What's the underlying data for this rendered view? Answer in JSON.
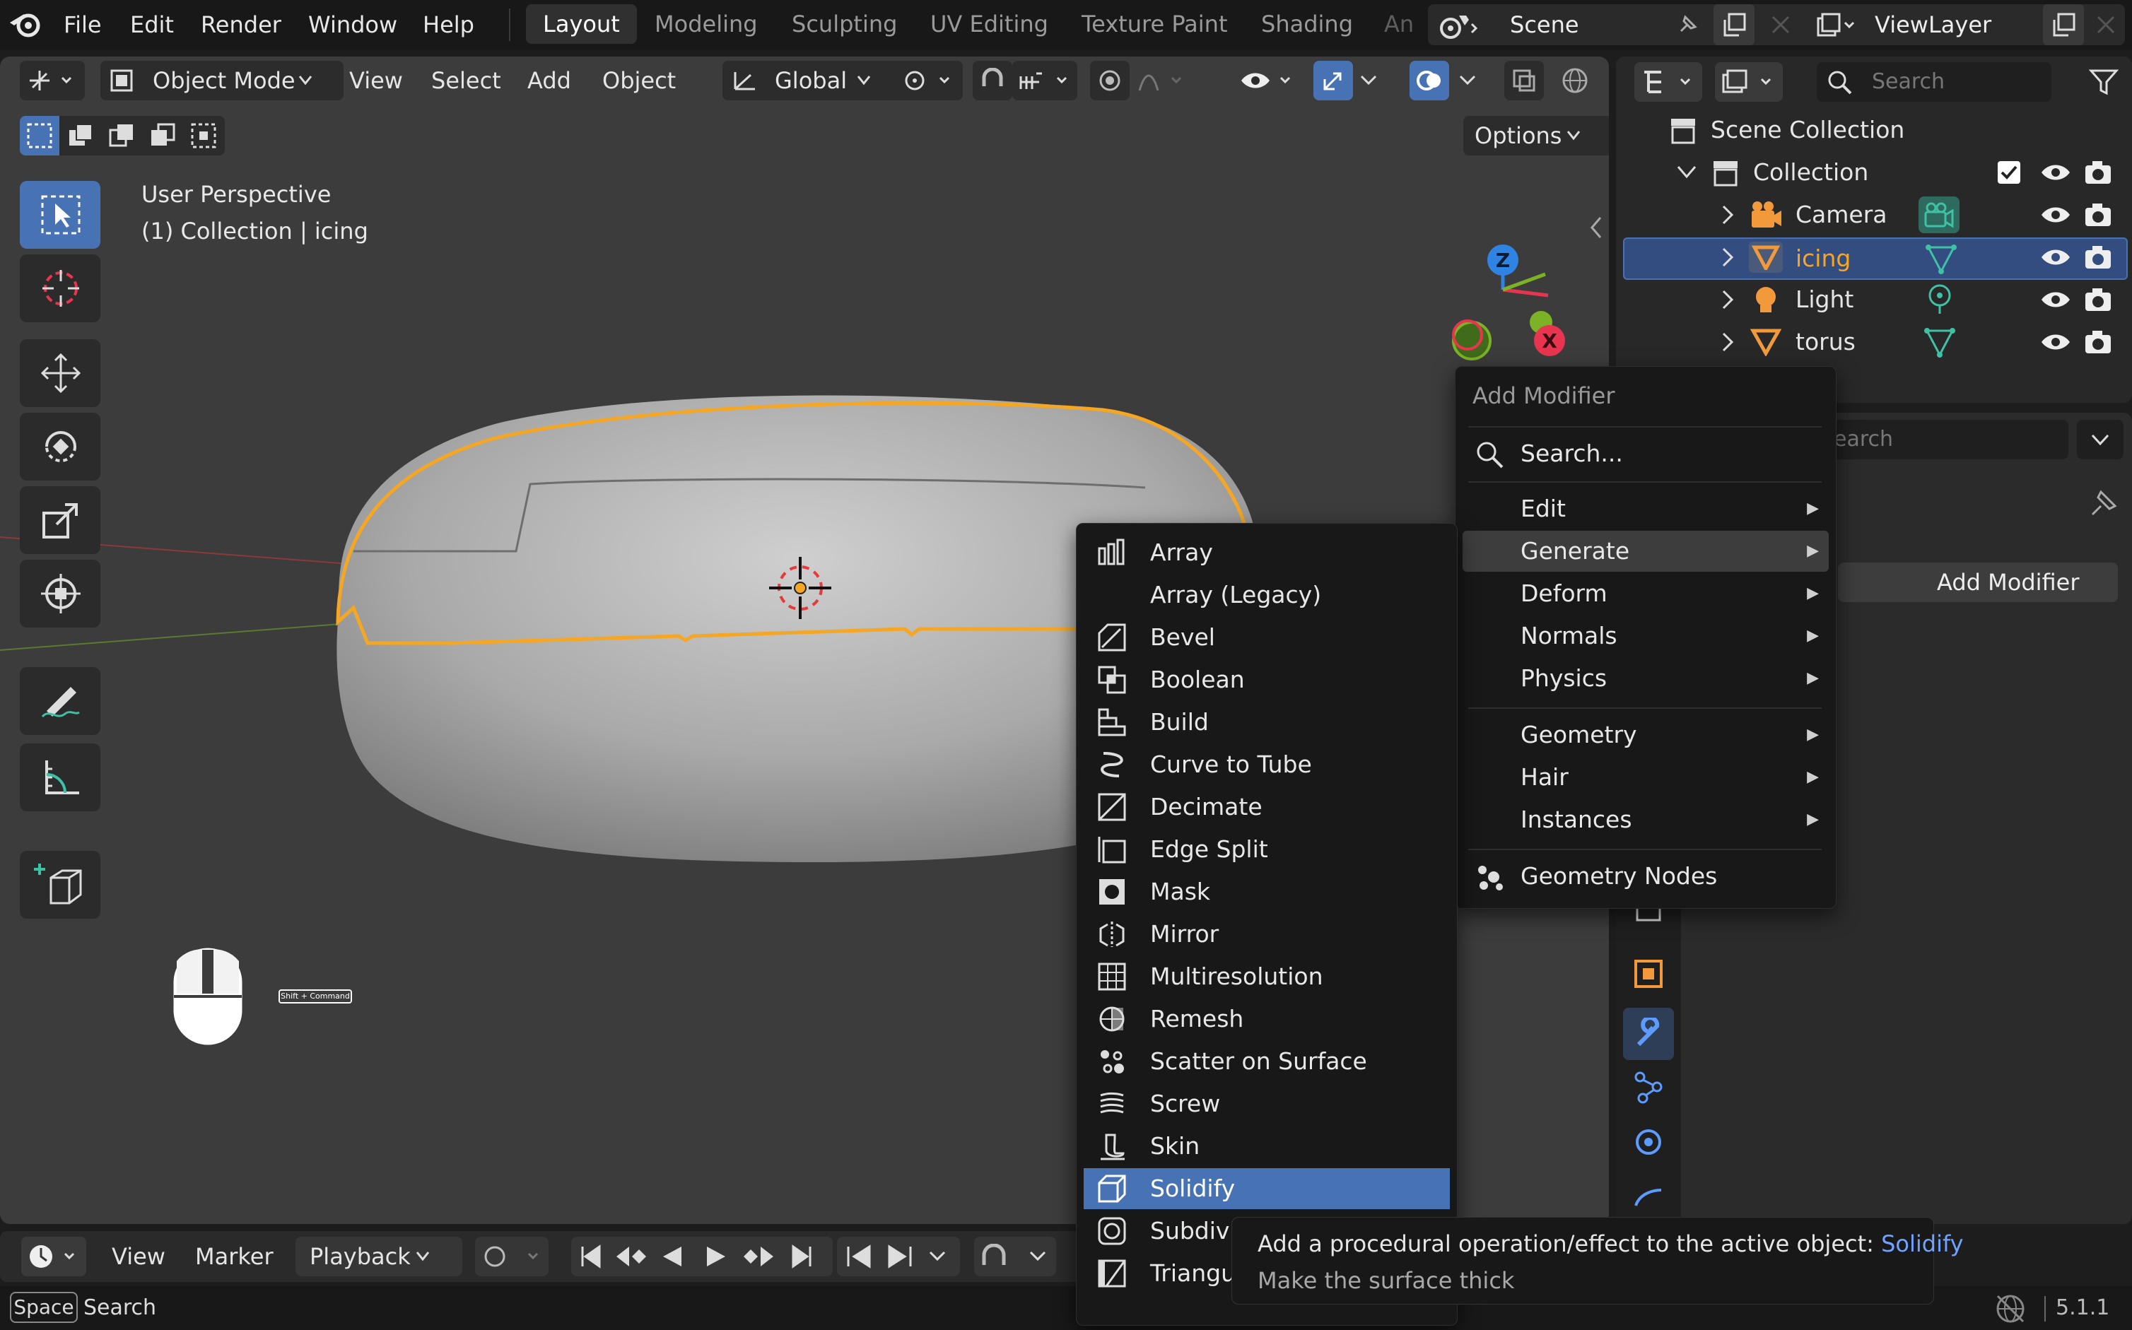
{
  "menubar": {
    "items": [
      "File",
      "Edit",
      "Render",
      "Window",
      "Help"
    ],
    "workspaces": [
      "Layout",
      "Modeling",
      "Sculpting",
      "UV Editing",
      "Texture Paint",
      "Shading",
      "An"
    ],
    "active_workspace": "Layout",
    "scene": "Scene",
    "view_layer": "ViewLayer"
  },
  "viewport": {
    "mode": "Object Mode",
    "menus": [
      "View",
      "Select",
      "Add",
      "Object"
    ],
    "orientation": "Global",
    "options_label": "Options",
    "overlay_line1": "User Perspective",
    "overlay_line2": "(1) Collection | icing",
    "shortcut_hint": "Shift + Command",
    "gizmo_axes": {
      "z": "Z",
      "x": "X"
    }
  },
  "timeline": {
    "menus": [
      "View",
      "Marker"
    ],
    "playback": "Playback"
  },
  "statusbar": {
    "key": "Space",
    "key_action": "Search",
    "version": "5.1.1"
  },
  "outliner": {
    "search_placeholder": "Search",
    "root": "Scene Collection",
    "collection": "Collection",
    "objects": [
      {
        "name": "Camera",
        "type": "camera"
      },
      {
        "name": "icing",
        "type": "mesh",
        "selected": true
      },
      {
        "name": "Light",
        "type": "light"
      },
      {
        "name": "torus",
        "type": "mesh"
      }
    ]
  },
  "properties": {
    "search_fragment": "earch",
    "add_modifier_button": "Add Modifier"
  },
  "add_modifier_menu": {
    "title": "Add Modifier",
    "search": "Search...",
    "items": [
      "Edit",
      "Generate",
      "Deform",
      "Normals",
      "Physics",
      "Geometry",
      "Hair",
      "Instances"
    ],
    "highlighted": "Generate",
    "geometry_nodes": "Geometry Nodes"
  },
  "generate_menu": {
    "items": [
      "Array",
      "Array (Legacy)",
      "Bevel",
      "Boolean",
      "Build",
      "Curve to Tube",
      "Decimate",
      "Edge Split",
      "Mask",
      "Mirror",
      "Multiresolution",
      "Remesh",
      "Scatter on Surface",
      "Screw",
      "Skin",
      "Solidify",
      "Subdivis",
      "Triangul"
    ],
    "highlighted": "Solidify"
  },
  "tooltip": {
    "line1_prefix": "Add a procedural operation/effect to the active object: ",
    "line1_name": "Solidify",
    "line2": "Make the surface thick"
  },
  "colors": {
    "accent_blue": "#4772b3",
    "selection_orange": "#f5a623",
    "axis_x": "#e8354f",
    "axis_y": "#7bb226",
    "axis_z": "#2f84e3",
    "tooltip_highlight": "#6fa3ff",
    "mesh_icon": "#f29a3b",
    "data_icon": "#3fc1a5"
  }
}
